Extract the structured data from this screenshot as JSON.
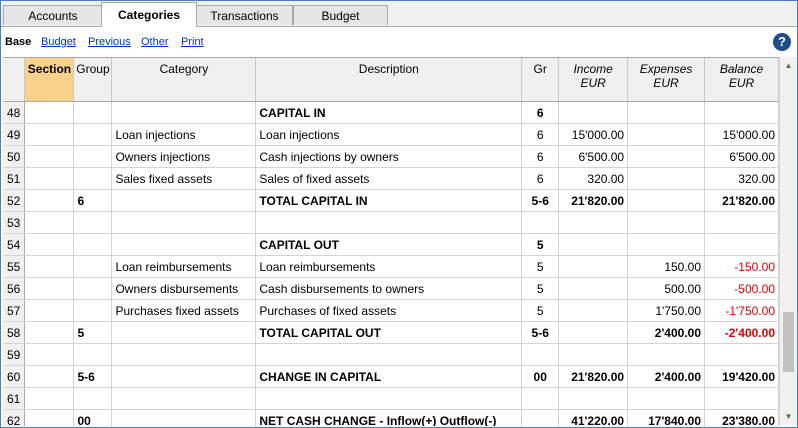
{
  "tabs": [
    "Accounts",
    "Categories",
    "Transactions",
    "Budget"
  ],
  "active_tab": "Categories",
  "views": [
    "Base",
    "Budget",
    "Previous",
    "Other",
    "Print"
  ],
  "help_label": "?",
  "columns": [
    "Section",
    "Group",
    "Category",
    "Description",
    "Gr",
    "Income EUR",
    "Expenses EUR",
    "Balance EUR"
  ],
  "rows": [
    {
      "n": "48",
      "section": "",
      "group": "",
      "category": "",
      "description": "CAPITAL IN",
      "gr": "6",
      "income": "",
      "expenses": "",
      "balance": "",
      "bold": true
    },
    {
      "n": "49",
      "section": "",
      "group": "",
      "category": "Loan injections",
      "description": "Loan injections",
      "gr": "6",
      "income": "15'000.00",
      "expenses": "",
      "balance": "15'000.00",
      "bold": false
    },
    {
      "n": "50",
      "section": "",
      "group": "",
      "category": "Owners injections",
      "description": "Cash injections by owners",
      "gr": "6",
      "income": "6'500.00",
      "expenses": "",
      "balance": "6'500.00",
      "bold": false
    },
    {
      "n": "51",
      "section": "",
      "group": "",
      "category": "Sales fixed assets",
      "description": "Sales of fixed assets",
      "gr": "6",
      "income": "320.00",
      "expenses": "",
      "balance": "320.00",
      "bold": false
    },
    {
      "n": "52",
      "section": "",
      "group": "6",
      "category": "",
      "description": "TOTAL CAPITAL IN",
      "gr": "5-6",
      "income": "21'820.00",
      "expenses": "",
      "balance": "21'820.00",
      "bold": true
    },
    {
      "n": "53",
      "section": "",
      "group": "",
      "category": "",
      "description": "",
      "gr": "",
      "income": "",
      "expenses": "",
      "balance": "",
      "bold": false
    },
    {
      "n": "54",
      "section": "",
      "group": "",
      "category": "",
      "description": "CAPITAL OUT",
      "gr": "5",
      "income": "",
      "expenses": "",
      "balance": "",
      "bold": true
    },
    {
      "n": "55",
      "section": "",
      "group": "",
      "category": "Loan reimbursements",
      "description": "Loan reimbursements",
      "gr": "5",
      "income": "",
      "expenses": "150.00",
      "balance": "-150.00",
      "bold": false
    },
    {
      "n": "56",
      "section": "",
      "group": "",
      "category": "Owners disbursements",
      "description": "Cash disbursements to owners",
      "gr": "5",
      "income": "",
      "expenses": "500.00",
      "balance": "-500.00",
      "bold": false
    },
    {
      "n": "57",
      "section": "",
      "group": "",
      "category": "Purchases fixed assets",
      "description": "Purchases of fixed assets",
      "gr": "5",
      "income": "",
      "expenses": "1'750.00",
      "balance": "-1'750.00",
      "bold": false
    },
    {
      "n": "58",
      "section": "",
      "group": "5",
      "category": "",
      "description": "TOTAL CAPITAL OUT",
      "gr": "5-6",
      "income": "",
      "expenses": "2'400.00",
      "balance": "-2'400.00",
      "bold": true
    },
    {
      "n": "59",
      "section": "",
      "group": "",
      "category": "",
      "description": "",
      "gr": "",
      "income": "",
      "expenses": "",
      "balance": "",
      "bold": false
    },
    {
      "n": "60",
      "section": "",
      "group": "5-6",
      "category": "",
      "description": "CHANGE IN CAPITAL",
      "gr": "00",
      "income": "21'820.00",
      "expenses": "2'400.00",
      "balance": "19'420.00",
      "bold": true
    },
    {
      "n": "61",
      "section": "",
      "group": "",
      "category": "",
      "description": "",
      "gr": "",
      "income": "",
      "expenses": "",
      "balance": "",
      "bold": false
    },
    {
      "n": "62",
      "section": "",
      "group": "00",
      "category": "",
      "description": "NET CASH CHANGE -  Inflow(+) Outflow(-)",
      "gr": "",
      "income": "41'220.00",
      "expenses": "17'840.00",
      "balance": "23'380.00",
      "bold": true
    }
  ]
}
